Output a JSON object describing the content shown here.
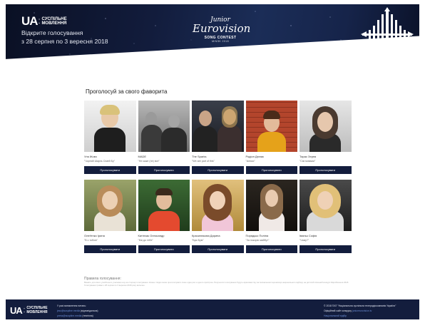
{
  "header": {
    "logo_ua": "UA",
    "logo_line1": "СУСПІЛЬНЕ",
    "logo_line2": "МОВЛЕННЯ",
    "vote_open_line1": "Відкрите голосування",
    "vote_open_line2": "з 28 серпня по 3 вересня 2018",
    "jesc_junior": "Junior",
    "jesc_eurovision": "Eurovision",
    "jesc_song_contest": "SONG CONTEST",
    "jesc_city": "MINSK 2018"
  },
  "main": {
    "section_title": "Проголосуй за свого фаворита",
    "vote_button_label": "Проголосувати",
    "contestants_row1": [
      {
        "name": "Уля Жовч",
        "song": "\"Чорний Шарль Сімей Бу\""
      },
      {
        "name": "MADE",
        "song": "\"Не каже (не) все\""
      },
      {
        "name": "The Sparks",
        "song": "\"We are part of this\""
      },
      {
        "name": "Родіон Дюник",
        "song": "\"Алюкс\""
      },
      {
        "name": "Тарас Зерня",
        "song": "\"Сім мовами\""
      }
    ],
    "contestants_row2": [
      {
        "name": "Олеґенко Ірина",
        "song": "\"В з тобою\""
      },
      {
        "name": "Катінчак Олександр",
        "song": "\"Ми до тебе\""
      },
      {
        "name": "Красилюкова Дарина",
        "song": "\"Бум Бум\""
      },
      {
        "name": "Порядько Поліна",
        "song": "\"За покорю майбут\""
      },
      {
        "name": "Іваніш Софія",
        "song": "\"Чому?\""
      }
    ]
  },
  "rules": {
    "title": "Правила голосування:",
    "text": "Вкажіть для свого улюбленого учасника шоу на сторінці голосування. Кожен глядач може проголосувати лише один раз з одного пристрою. Результати голосування будуть враховані під час визначення переможця національного відбору на дитячий пісенний конкурс Євробачення 2018. Голосування триває з 28 серпня по 3 вересня 2018 року включно."
  },
  "footer": {
    "logo_ua": "UA",
    "logo_line1": "СУСПІЛЬНЕ",
    "logo_line2": "МОВЛЕННЯ",
    "mid_line1": "У разі виникнення питань:",
    "mid_line2_link": "jesc@suspilne.media",
    "mid_line2_rest": "(відповідальна)",
    "mid_line3_link": "press@suspilne.media",
    "mid_line3_rest": "(технічна)",
    "copyright": "© 2018 ПАТ \"Національна суспільна телерадіокомпанія України\"",
    "official_site": "Офіційний сайт конкурсу",
    "official_site_link": "junioreurovision.tv",
    "national_link": "Національний відбір"
  },
  "colors": {
    "navy": "#131d3d",
    "header_dark": "#0a1024"
  }
}
